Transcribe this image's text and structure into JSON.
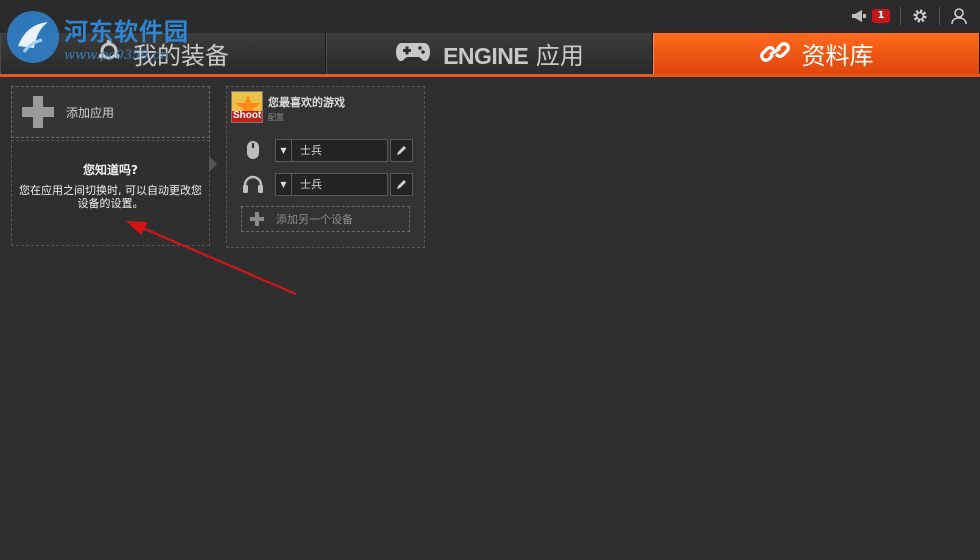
{
  "watermark": {
    "title": "河东软件园",
    "url": "www.pc0359.cn"
  },
  "topbar": {
    "notification_count": "1",
    "icons": [
      "megaphone-icon",
      "gear-icon",
      "user-icon"
    ]
  },
  "nav": {
    "tabs": [
      {
        "label": "我的装备",
        "icon": "steelseries-logo-icon",
        "active": false
      },
      {
        "engine": "ENGINE",
        "label": "应用",
        "icon": "gamepad-icon",
        "active": false
      },
      {
        "label": "资料库",
        "icon": "link-icon",
        "active": true
      }
    ],
    "accent": "#e8581a"
  },
  "left": {
    "add_app_label": "添加应用",
    "tip_title": "您知道吗?",
    "tip_text": "您在应用之间切换时, 可以自动更改您设备的设置。"
  },
  "card": {
    "game_name": "您最喜欢的游戏",
    "game_sub": "配置",
    "game_icon_text": "Shoot",
    "devices": [
      {
        "icon": "mouse-icon",
        "value": "士兵"
      },
      {
        "icon": "headset-icon",
        "value": "士兵"
      }
    ],
    "add_device_label": "添加另一个设备"
  }
}
